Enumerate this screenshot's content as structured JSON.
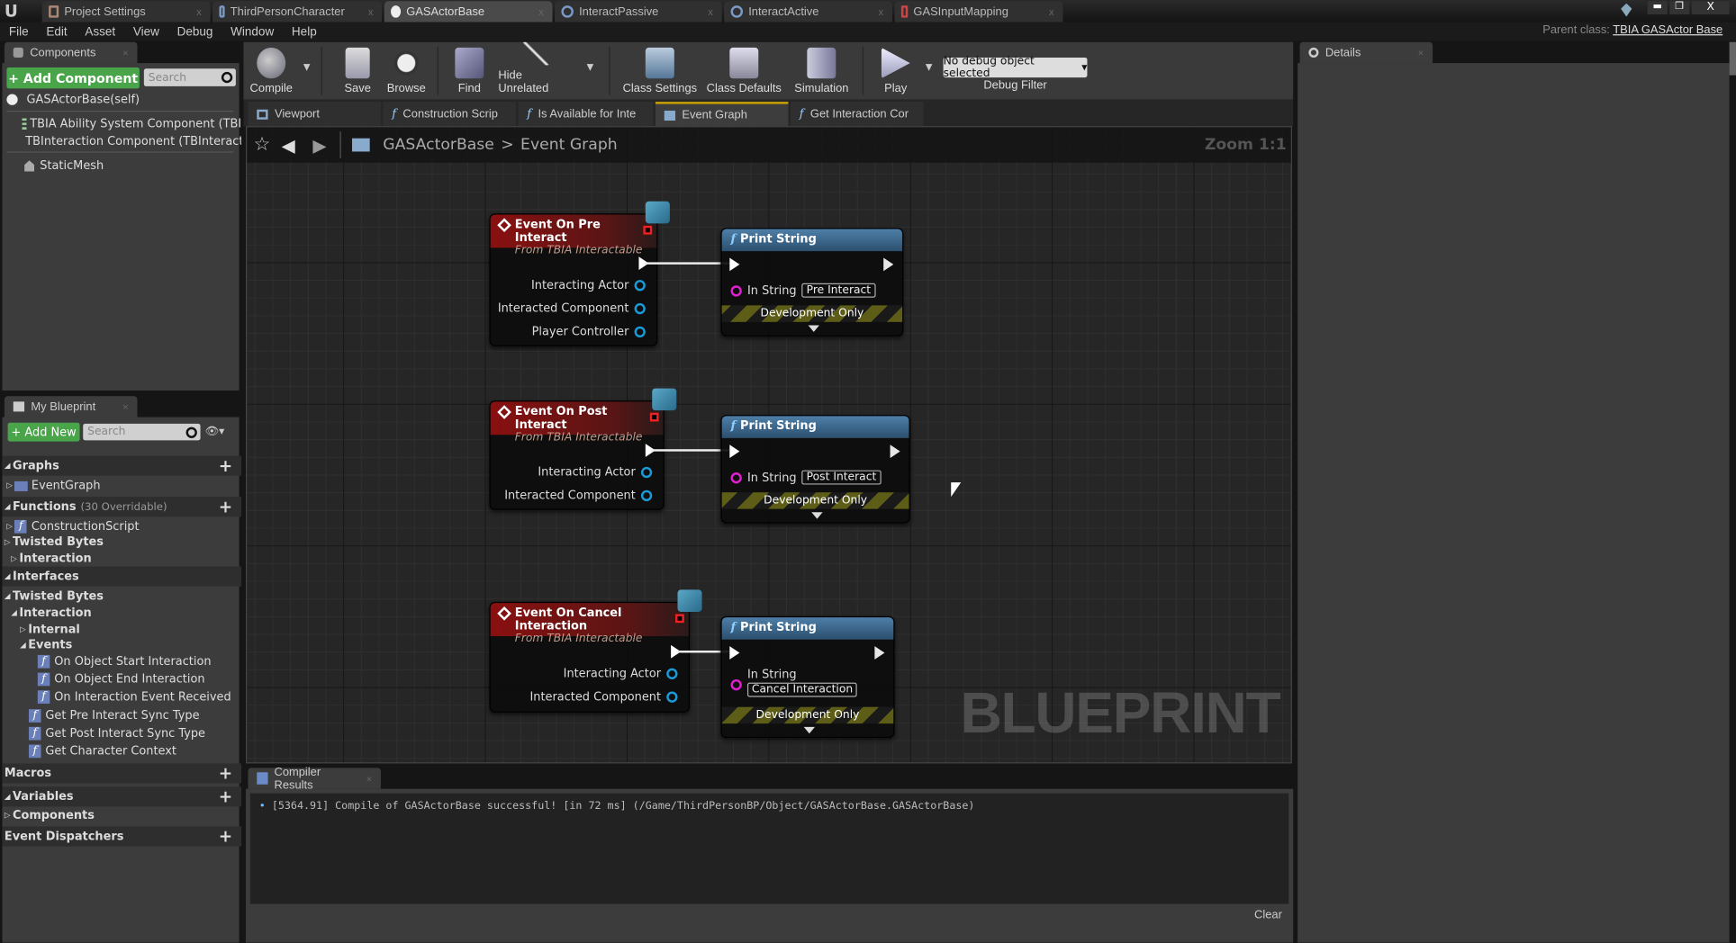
{
  "window": {
    "tabs": [
      {
        "label": "Project Settings",
        "active": false
      },
      {
        "label": "ThirdPersonCharacter",
        "active": false
      },
      {
        "label": "GASActorBase",
        "active": true
      },
      {
        "label": "InteractPassive",
        "active": false
      },
      {
        "label": "InteractActive",
        "active": false
      },
      {
        "label": "GASInputMapping",
        "active": false
      }
    ],
    "close": "x"
  },
  "menu": {
    "items": [
      "File",
      "Edit",
      "Asset",
      "View",
      "Debug",
      "Window",
      "Help"
    ],
    "parent_class_label": "Parent class:",
    "parent_class_value": "TBIA GASActor Base"
  },
  "components": {
    "tab": "Components",
    "add_label": "+ Add Component",
    "search_placeholder": "Search",
    "items": [
      "GASActorBase(self)",
      "TBIA Ability System Component (TBIA_Al",
      "TBInteraction Component (TBInteraction",
      "StaticMesh"
    ]
  },
  "my_blueprint": {
    "tab": "My Blueprint",
    "add_label": "+ Add New",
    "search_placeholder": "Search",
    "rows": [
      {
        "label": "Graphs",
        "type": "cat"
      },
      {
        "label": "EventGraph",
        "type": "item"
      },
      {
        "label": "Functions",
        "type": "cat",
        "extra": "(30 Overridable)"
      },
      {
        "label": "ConstructionScript",
        "type": "item"
      },
      {
        "label": "Twisted Bytes",
        "type": "sub"
      },
      {
        "label": "Interaction",
        "type": "sub2"
      },
      {
        "label": "Interfaces",
        "type": "cat"
      },
      {
        "label": "Twisted Bytes",
        "type": "sub"
      },
      {
        "label": "Interaction",
        "type": "sub2"
      },
      {
        "label": "Internal",
        "type": "sub3"
      },
      {
        "label": "Events",
        "type": "sub3"
      },
      {
        "label": "On Object Start Interaction",
        "type": "fn4"
      },
      {
        "label": "On Object End Interaction",
        "type": "fn4"
      },
      {
        "label": "On Interaction Event Received",
        "type": "fn4"
      },
      {
        "label": "Get Pre Interact Sync Type",
        "type": "fn3"
      },
      {
        "label": "Get Post Interact Sync Type",
        "type": "fn3"
      },
      {
        "label": "Get Character Context",
        "type": "fn3"
      },
      {
        "label": "Macros",
        "type": "cat"
      },
      {
        "label": "Variables",
        "type": "cat"
      },
      {
        "label": "Components",
        "type": "sub"
      },
      {
        "label": "Event Dispatchers",
        "type": "cat"
      }
    ]
  },
  "toolbar": {
    "compile": "Compile",
    "save": "Save",
    "browse": "Browse",
    "find": "Find",
    "hide_unrelated": "Hide Unrelated",
    "class_settings": "Class Settings",
    "class_defaults": "Class Defaults",
    "simulation": "Simulation",
    "play": "Play",
    "debug_object": "No debug object selected",
    "debug_filter": "Debug Filter"
  },
  "graph_tabs": [
    {
      "label": "Viewport"
    },
    {
      "label": "Construction Scrip"
    },
    {
      "label": "Is Available for Inte"
    },
    {
      "label": "Event Graph",
      "active": true
    },
    {
      "label": "Get Interaction Cor"
    }
  ],
  "breadcrumb": {
    "blueprint": "GASActorBase",
    "separator": ">",
    "graph": "Event Graph",
    "zoom": "Zoom 1:1"
  },
  "watermark": "BLUEPRINT",
  "nodes": [
    {
      "title": "Event On Pre Interact",
      "subtitle": "From TBIA Interactable",
      "pins": [
        "Interacting Actor",
        "Interacted Component",
        "Player Controller"
      ],
      "print_title": "Print String",
      "in_label": "In String",
      "in_value": "Pre Interact",
      "dev": "Development Only"
    },
    {
      "title": "Event On Post Interact",
      "subtitle": "From TBIA Interactable",
      "pins": [
        "Interacting Actor",
        "Interacted Component"
      ],
      "print_title": "Print String",
      "in_label": "In String",
      "in_value": "Post Interact",
      "dev": "Development Only"
    },
    {
      "title": "Event On Cancel Interaction",
      "subtitle": "From TBIA Interactable",
      "pins": [
        "Interacting Actor",
        "Interacted Component"
      ],
      "print_title": "Print String",
      "in_label": "In String",
      "in_value": "Cancel Interaction",
      "dev": "Development Only"
    }
  ],
  "compiler": {
    "tab": "Compiler Results",
    "message": "[5364.91] Compile of GASActorBase successful! [in 72 ms] (/Game/ThirdPersonBP/Object/GASActorBase.GASActorBase)",
    "clear": "Clear"
  },
  "details": {
    "tab": "Details"
  }
}
